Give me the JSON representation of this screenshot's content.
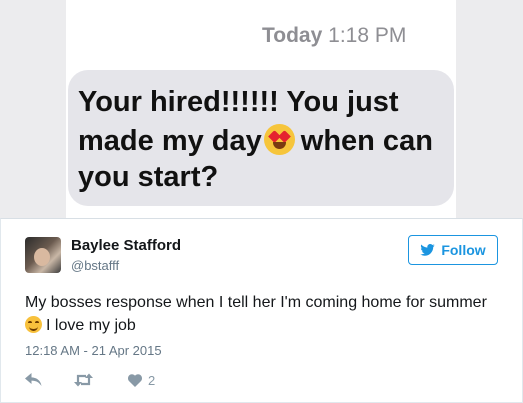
{
  "screenshot": {
    "time_label": "Today",
    "time_value": "1:18 PM",
    "message_line1": "Your hired!!!!!! You just",
    "message_line2a": "made my day",
    "message_line2b": "when can",
    "message_line3": "you start?",
    "emoji": "heart-eyes-emoji"
  },
  "tweet": {
    "display_name": "Baylee Stafford",
    "handle": "@bstafff",
    "follow_label": "Follow",
    "text_line1": "My bosses response when I tell her I'm coming home for summer",
    "text_line2": "I love my job",
    "timestamp": "12:18 AM - 21 Apr 2015",
    "like_count": "2"
  },
  "colors": {
    "accent": "#1b95e0",
    "muted": "#657786",
    "bubble": "#e5e5ea"
  }
}
